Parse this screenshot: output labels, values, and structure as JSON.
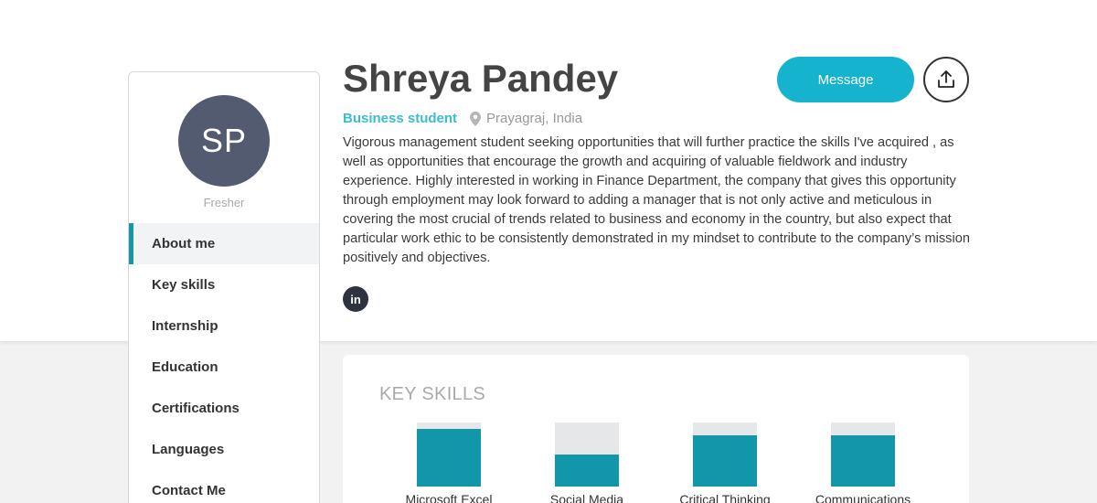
{
  "profile": {
    "initials": "SP",
    "status": "Fresher",
    "name": "Shreya Pandey",
    "role": "Business student",
    "location": "Prayagraj, India",
    "bio": "Vigorous management student seeking opportunities that will further practice the skills I've acquired , as well as opportunities that encourage the growth and acquiring of valuable fieldwork and industry experience. Highly interested in working in Finance Department, the company that gives this opportunity through employment may look forward to adding a manager that is not only active and meticulous in covering the most crucial of trends related to business and economy in the country, but also expect that particular work ethic to be consistently demonstrated in my mindset to contribute to the company’s mission positively and objectives.",
    "linkedin_label": "in"
  },
  "actions": {
    "message_label": "Message",
    "share_icon": "share-upload-icon"
  },
  "sidebar": {
    "items": [
      {
        "label": "About me",
        "active": true
      },
      {
        "label": "Key skills",
        "active": false
      },
      {
        "label": "Internship",
        "active": false
      },
      {
        "label": "Education",
        "active": false
      },
      {
        "label": "Certifications",
        "active": false
      },
      {
        "label": "Languages",
        "active": false
      },
      {
        "label": "Contact Me",
        "active": false
      }
    ]
  },
  "key_skills": {
    "title": "KEY SKILLS",
    "skills": [
      {
        "label": "Microsoft Excel",
        "level": 0.9
      },
      {
        "label": "Social Media",
        "level": 0.5
      },
      {
        "label": "Critical Thinking",
        "level": 0.8
      },
      {
        "label": "Communications",
        "level": 0.8
      }
    ]
  },
  "colors": {
    "accent": "#16b3cf",
    "skill_fill": "#1297aa",
    "avatar_bg": "#535b71"
  }
}
